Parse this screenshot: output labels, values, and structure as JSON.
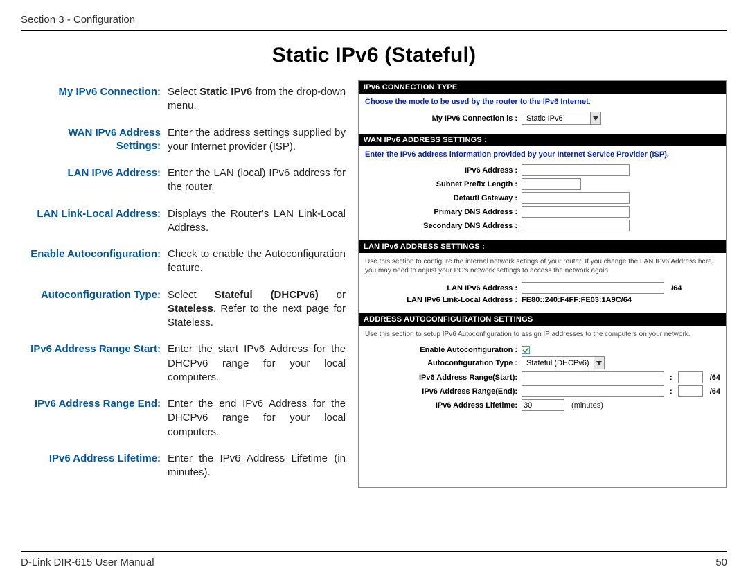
{
  "header": {
    "section": "Section 3 - Configuration"
  },
  "title": "Static IPv6 (Stateful)",
  "defs": [
    {
      "term": "My IPv6 Connection:",
      "desc_pre": "Select ",
      "desc_bold": "Static IPv6",
      "desc_post": " from the drop-down menu."
    },
    {
      "term": "WAN IPv6 Address Settings:",
      "desc_pre": "Enter the address settings supplied by your Internet provider (ISP).",
      "desc_bold": "",
      "desc_post": ""
    },
    {
      "term": "LAN IPv6 Address:",
      "desc_pre": "Enter the LAN (local) IPv6 address for the router.",
      "desc_bold": "",
      "desc_post": ""
    },
    {
      "term": "LAN Link-Local Address:",
      "desc_pre": "Displays the Router's LAN Link-Local Address.",
      "desc_bold": "",
      "desc_post": ""
    },
    {
      "term": "Enable Autoconfiguration:",
      "desc_pre": "Check to enable the Autoconfiguration feature.",
      "desc_bold": "",
      "desc_post": ""
    },
    {
      "term": "Autoconfiguration Type:",
      "desc_pre": "Select ",
      "desc_bold": "Stateful (DHCPv6)",
      "desc_mid": " or ",
      "desc_bold2": "Stateless",
      "desc_post": ". Refer to the next page for Stateless."
    },
    {
      "term": "IPv6 Address Range Start:",
      "desc_pre": "Enter the start IPv6 Address for the DHCPv6 range for your local computers.",
      "desc_bold": "",
      "desc_post": ""
    },
    {
      "term": "IPv6 Address Range End:",
      "desc_pre": "Enter the end IPv6 Address for the DHCPv6 range for your local computers.",
      "desc_bold": "",
      "desc_post": ""
    },
    {
      "term": "IPv6 Address Lifetime:",
      "desc_pre": "Enter the IPv6 Address Lifetime (in minutes).",
      "desc_bold": "",
      "desc_post": ""
    }
  ],
  "ui": {
    "sec1": {
      "bar": "IPv6 CONNECTION TYPE",
      "hint": "Choose the mode to be used by the router to the IPv6 Internet.",
      "label": "My IPv6 Connection is :",
      "select": "Static IPv6"
    },
    "sec2": {
      "bar": "WAN IPv6 ADDRESS SETTINGS :",
      "hint": "Enter the IPv6 address information provided by your Internet Service Provider (ISP).",
      "f1": "IPv6 Address :",
      "f2": "Subnet Prefix Length :",
      "f3": "Defautl Gateway :",
      "f4": "Primary DNS Address :",
      "f5": "Secondary DNS Address :"
    },
    "sec3": {
      "bar": "LAN IPv6 ADDRESS SETTINGS :",
      "hint": "Use this section to configure the internal network setings of your router. If you change the LAN IPv6 Address here, you may need to adjust your PC's network settings to access the network again.",
      "f1": "LAN IPv6 Address :",
      "suffix1": "/64",
      "f2": "LAN IPv6 Link-Local Address :",
      "v2": "FE80::240:F4FF:FE03:1A9C/64"
    },
    "sec4": {
      "bar": "ADDRESS AUTOCONFIGURATION SETTINGS",
      "hint": "Use this section to setup IPv6 Autoconfiguration to assign IP addresses to the computers on your network.",
      "f1": "Enable Autoconfiguration :",
      "f2": "Autoconfiguration Type :",
      "select": "Stateful (DHCPv6)",
      "f3": "IPv6 Address Range(Start):",
      "f4": "IPv6 Address Range(End):",
      "suffix": "/64",
      "colon": ":",
      "f5": "IPv6 Address Lifetime:",
      "v5": "30",
      "unit": "(minutes)"
    }
  },
  "footer": {
    "left": "D-Link DIR-615 User Manual",
    "right": "50"
  }
}
